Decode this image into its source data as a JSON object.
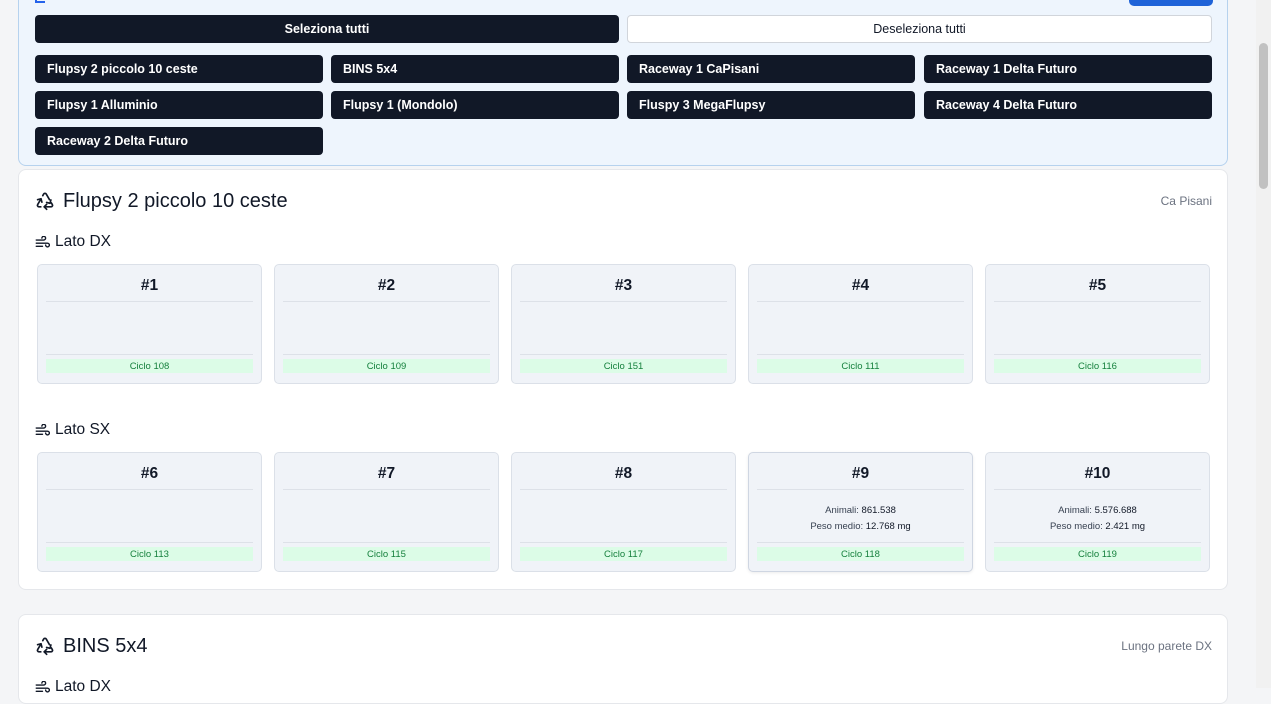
{
  "filters": {
    "select_all": "Seleziona tutti",
    "deselect_all": "Deseleziona tutti",
    "flupsy_buttons": [
      "Flupsy 2 piccolo 10 ceste",
      "BINS 5x4",
      "Raceway 1 CaPisani",
      "Raceway 1 Delta Futuro",
      "Flupsy 1 Alluminio",
      "Flupsy 1 (Mondolo)",
      "Fluspy 3 MegaFlupsy",
      "Raceway 4 Delta Futuro",
      "Raceway 2 Delta Futuro"
    ]
  },
  "sections": [
    {
      "title": "Flupsy 2 piccolo 10 ceste",
      "location": "Ca Pisani",
      "sides": [
        {
          "label": "Lato DX",
          "baskets": [
            {
              "number": "#1",
              "cycle": "Ciclo 108"
            },
            {
              "number": "#2",
              "cycle": "Ciclo 109"
            },
            {
              "number": "#3",
              "cycle": "Ciclo 151"
            },
            {
              "number": "#4",
              "cycle": "Ciclo 111"
            },
            {
              "number": "#5",
              "cycle": "Ciclo 116"
            }
          ]
        },
        {
          "label": "Lato SX",
          "baskets": [
            {
              "number": "#6",
              "cycle": "Ciclo 113"
            },
            {
              "number": "#7",
              "cycle": "Ciclo 115"
            },
            {
              "number": "#8",
              "cycle": "Ciclo 117"
            },
            {
              "number": "#9",
              "cycle": "Ciclo 118",
              "animals_label": "Animali:",
              "animals": "861.538",
              "weight_label": "Peso medio:",
              "weight": "12.768 mg"
            },
            {
              "number": "#10",
              "cycle": "Ciclo 119",
              "animals_label": "Animali:",
              "animals": "5.576.688",
              "weight_label": "Peso medio:",
              "weight": "2.421 mg"
            }
          ]
        }
      ]
    },
    {
      "title": "BINS 5x4",
      "location": "Lungo parete DX",
      "sides": [
        {
          "label": "Lato DX",
          "baskets": []
        }
      ]
    }
  ]
}
